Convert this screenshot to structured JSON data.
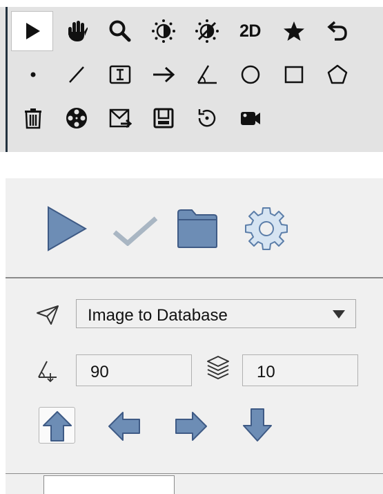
{
  "toolbar": {
    "rows": [
      [
        "select-pointer-icon",
        "hand-pan-icon",
        "zoom-magnifier-icon",
        "brightness-icon",
        "contrast-icon",
        "2D",
        "star-icon",
        "undo-icon"
      ],
      [
        "point-icon",
        "line-icon",
        "text-box-icon",
        "arrow-right-icon",
        "angle-icon",
        "circle-icon",
        "rectangle-icon",
        "pentagon-icon"
      ],
      [
        "trash-icon",
        "film-reel-icon",
        "export-image-icon",
        "save-disk-icon",
        "reset-rotate-icon",
        "video-camera-icon"
      ]
    ],
    "view_mode_label": "2D",
    "active_tool": "select-pointer-icon"
  },
  "panel": {
    "actions": [
      "play-icon",
      "checkmark-icon",
      "folder-icon",
      "settings-gear-icon"
    ],
    "mode_select": {
      "icon": "paper-plane-icon",
      "value": "Image to Database"
    },
    "angle_field": {
      "icon": "angle-icon",
      "value": "90"
    },
    "layers_field": {
      "icon": "layers-icon",
      "value": "10"
    },
    "direction_buttons": [
      "arrow-up-icon",
      "arrow-left-icon",
      "arrow-right-icon",
      "arrow-down-icon"
    ],
    "active_direction": "arrow-up-icon"
  },
  "colors": {
    "toolbar_bg": "#e3e3e3",
    "panel_bg": "#f0f0f0",
    "accent_blue": "#6d8db5",
    "check_gray": "#a9b6c3"
  }
}
